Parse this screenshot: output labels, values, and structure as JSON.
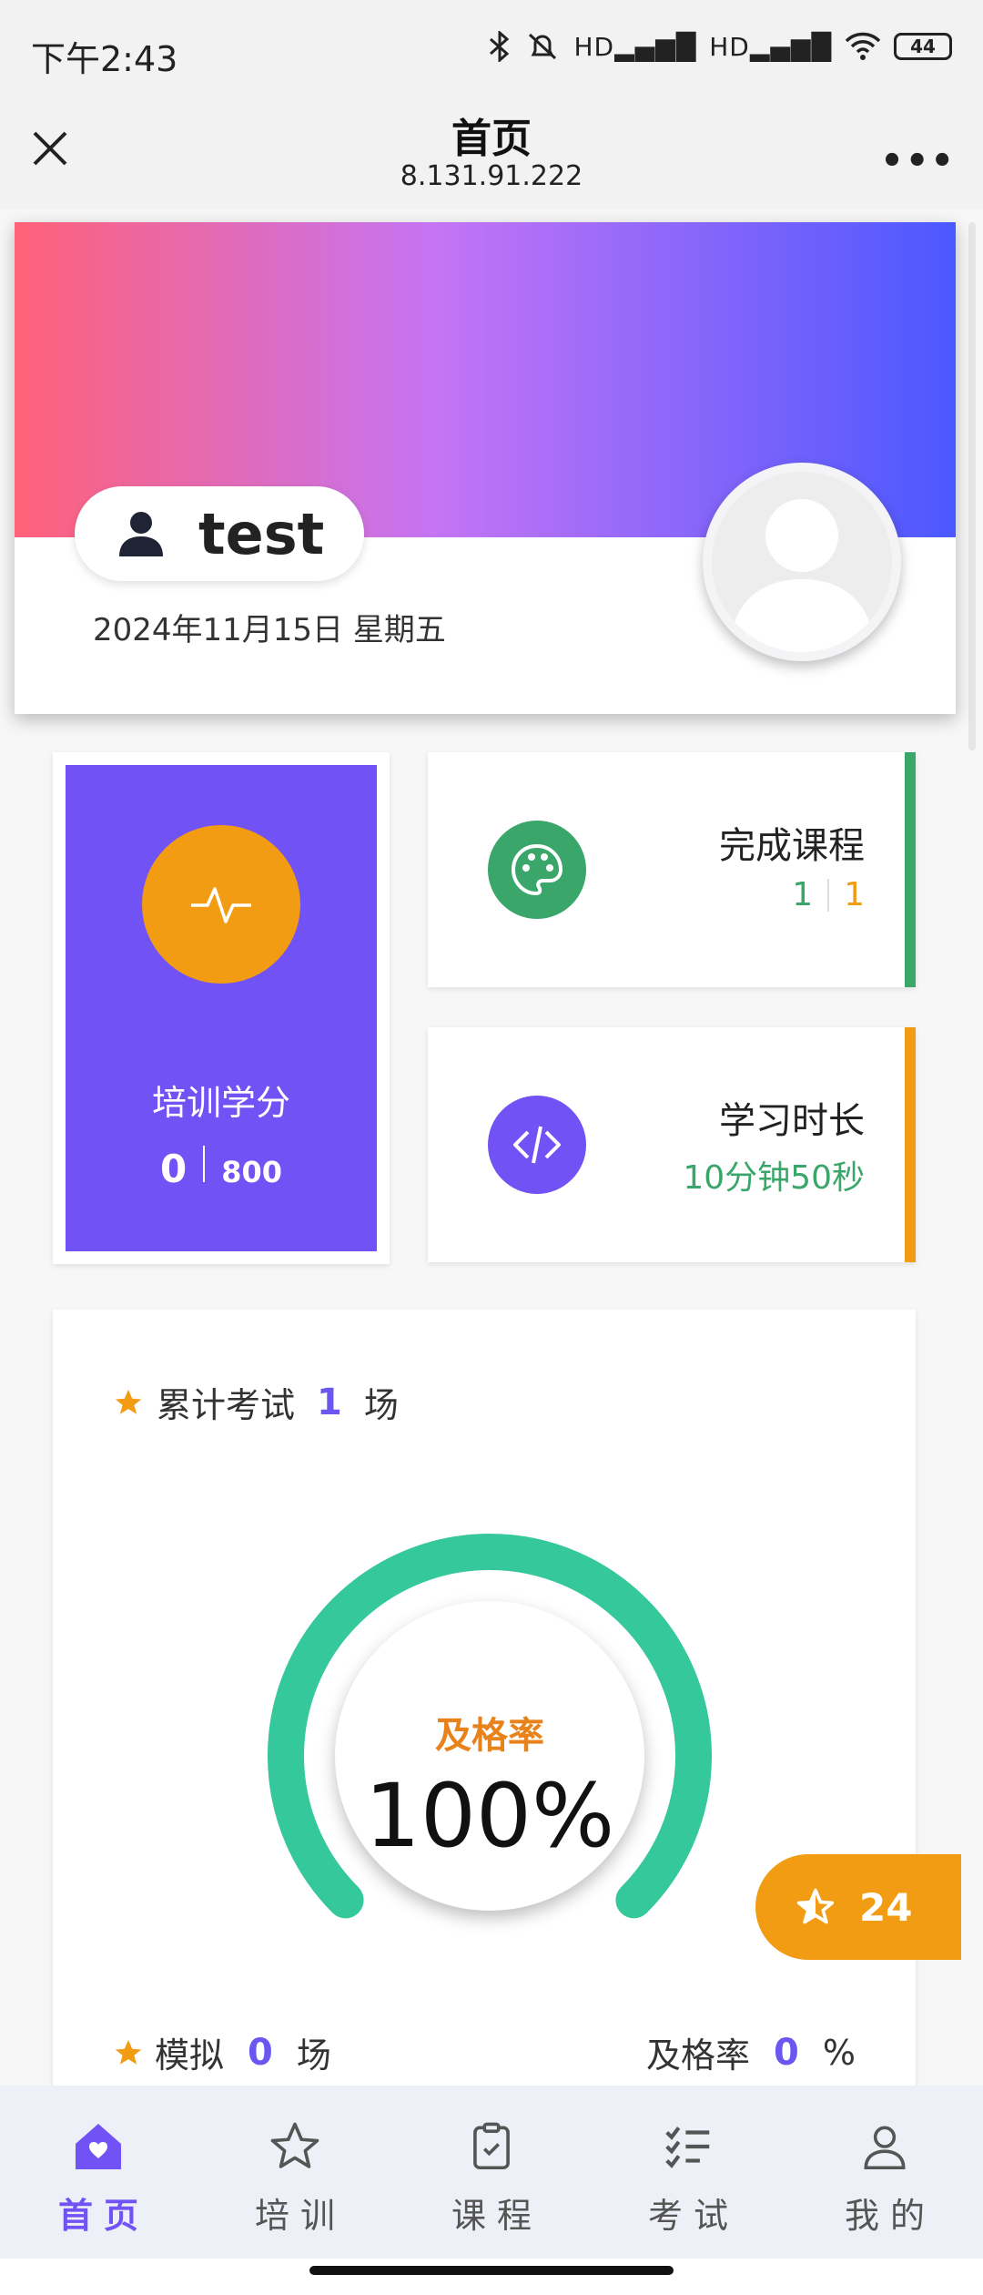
{
  "status_bar": {
    "time": "下午2:43",
    "signal1": "HD",
    "signal2": "HD",
    "battery": "44"
  },
  "header": {
    "title": "首页",
    "subtitle": "8.131.91.222",
    "close_icon": "close-icon",
    "more_icon": "more-icon"
  },
  "profile": {
    "username": "test",
    "date": "2024年11月15日 星期五",
    "gradient_colors": [
      "#ff6178",
      "#c474f5",
      "#4b58ff"
    ]
  },
  "credit": {
    "label": "培训学分",
    "value": "0",
    "total": "800",
    "bg_color": "#7152f5",
    "icon_color": "#f29c13"
  },
  "course": {
    "label": "完成课程",
    "completed": "1",
    "total": "1",
    "accent": "#3aa66a"
  },
  "study_time": {
    "label": "学习时长",
    "value": "10分钟50秒",
    "accent": "#f29c13"
  },
  "exam": {
    "prefix": "累计考试",
    "count": "1",
    "unit": "场",
    "gauge_label": "及格率",
    "gauge_value": "100%",
    "pass_rate": 1.0,
    "gauge_color": "#35c89a",
    "mock_label": "模拟",
    "mock_count": "0",
    "mock_unit": "场",
    "mock_rate_label": "及格率",
    "mock_rate": "0",
    "mock_rate_unit": "%"
  },
  "float_badge": {
    "value": "24"
  },
  "nav": {
    "items": [
      {
        "label": "首页",
        "icon": "home-icon",
        "active": true
      },
      {
        "label": "培训",
        "icon": "star-icon",
        "active": false
      },
      {
        "label": "课程",
        "icon": "clipboard-icon",
        "active": false
      },
      {
        "label": "考试",
        "icon": "checklist-icon",
        "active": false
      },
      {
        "label": "我的",
        "icon": "person-icon",
        "active": false
      }
    ]
  }
}
